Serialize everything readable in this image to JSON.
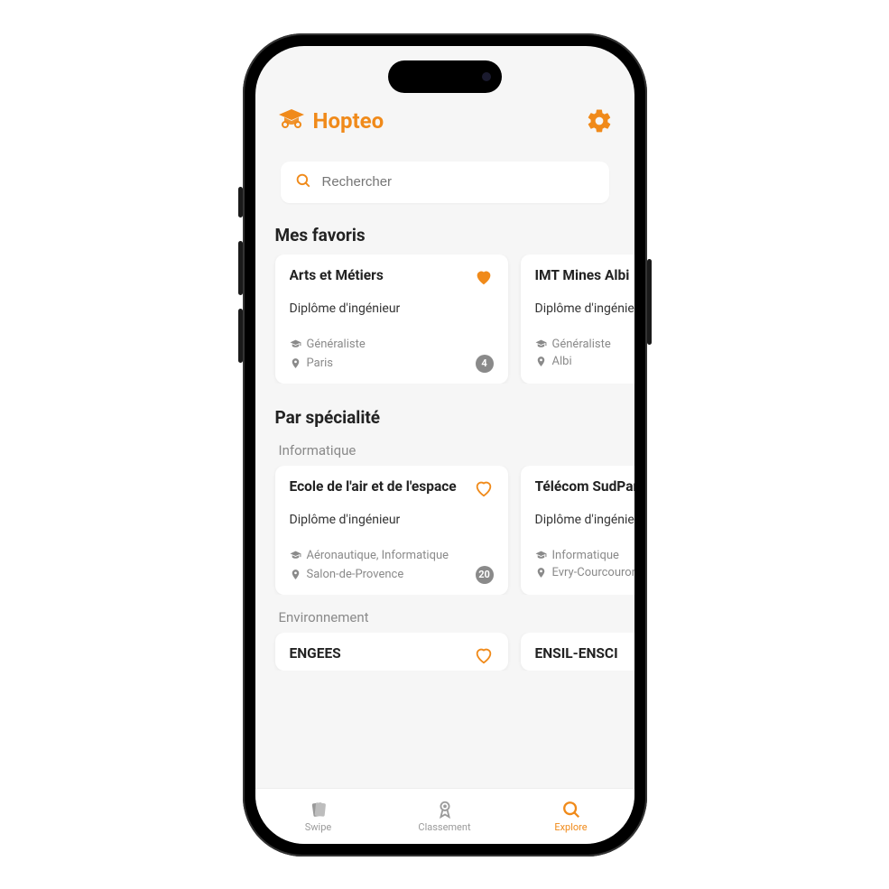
{
  "brand": {
    "name": "Hopteo"
  },
  "search": {
    "placeholder": "Rechercher"
  },
  "sections": {
    "favorites_title": "Mes favoris",
    "speciality_title": "Par spécialité",
    "speciality_groups": {
      "informatique": "Informatique",
      "environnement": "Environnement"
    }
  },
  "favorites": [
    {
      "title": "Arts et Métiers",
      "diploma": "Diplôme d'ingénieur",
      "speciality": "Généraliste",
      "location": "Paris",
      "badge": "4",
      "liked": true
    },
    {
      "title": "IMT Mines Albi",
      "diploma": "Diplôme d'ingénieur",
      "speciality": "Généraliste",
      "location": "Albi",
      "badge": "",
      "liked": true
    }
  ],
  "informatique": [
    {
      "title": "Ecole de l'air et de l'espace",
      "diploma": "Diplôme d'ingénieur",
      "speciality": "Aéronautique, Informatique",
      "location": "Salon-de-Provence",
      "badge": "20",
      "liked": false
    },
    {
      "title": "Télécom SudParis",
      "diploma": "Diplôme d'ingénieur",
      "speciality": "Informatique",
      "location": "Evry-Courcouronnes",
      "badge": "",
      "liked": false
    }
  ],
  "environnement": [
    {
      "title": "ENGEES",
      "liked": false
    },
    {
      "title": "ENSIL-ENSCI",
      "liked": false
    }
  ],
  "nav": {
    "swipe": "Swipe",
    "classement": "Classement",
    "explore": "Explore"
  }
}
